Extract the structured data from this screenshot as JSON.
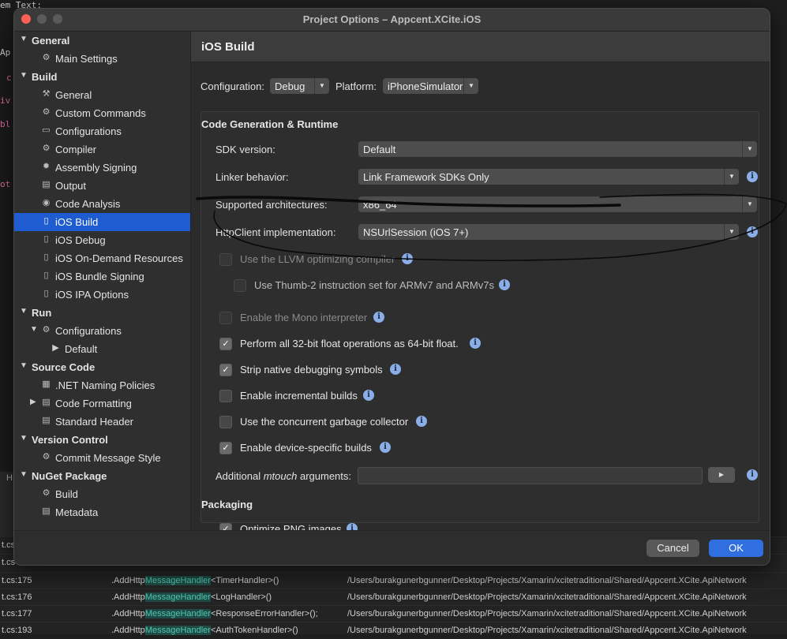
{
  "background_editor": {
    "code_lines": [
      "em Text;",
      "Ap",
      "c",
      "iv",
      "bl",
      "ot"
    ],
    "side_tab": "H"
  },
  "background_table": {
    "rows": [
      {
        "file": "t.cs:175",
        "prefix": ".AddHttp",
        "highlight": "MessageHandler",
        "suffix": "<TimerHandler>()",
        "path": "/Users/burakgunerbgunner/Desktop/Projects/Xamarin/xcitetraditional/Shared/Appcent.XCite.ApiNetwork"
      },
      {
        "file": "t.cs:176",
        "prefix": ".AddHttp",
        "highlight": "MessageHandler",
        "suffix": "<LogHandler>()",
        "path": "/Users/burakgunerbgunner/Desktop/Projects/Xamarin/xcitetraditional/Shared/Appcent.XCite.ApiNetwork"
      },
      {
        "file": "t.cs:177",
        "prefix": ".AddHttp",
        "highlight": "MessageHandler",
        "suffix": "<ResponseErrorHandler>();",
        "path": "/Users/burakgunerbgunner/Desktop/Projects/Xamarin/xcitetraditional/Shared/Appcent.XCite.ApiNetwork"
      },
      {
        "file": "t.cs:193",
        "prefix": ".AddHttp",
        "highlight": "MessageHandler",
        "suffix": "<AuthTokenHandler>()",
        "path": "/Users/burakgunerbgunner/Desktop/Projects/Xamarin/xcitetraditional/Shared/Appcent.XCite.ApiNetwork"
      }
    ],
    "partial_rows": [
      "t.cs",
      "t.cs"
    ]
  },
  "window": {
    "title": "Project Options – Appcent.XCite.iOS"
  },
  "sidebar": {
    "items": [
      {
        "label": "General",
        "type": "group",
        "icon": "chevron-down"
      },
      {
        "label": "Main Settings",
        "type": "item",
        "icon": "gear-icon"
      },
      {
        "label": "Build",
        "type": "group",
        "icon": "chevron-down"
      },
      {
        "label": "General",
        "type": "item",
        "icon": "hammer-icon"
      },
      {
        "label": "Custom Commands",
        "type": "item",
        "icon": "gear-icon"
      },
      {
        "label": "Configurations",
        "type": "item",
        "icon": "window-icon"
      },
      {
        "label": "Compiler",
        "type": "item",
        "icon": "compiler-icon"
      },
      {
        "label": "Assembly Signing",
        "type": "item",
        "icon": "seal-icon"
      },
      {
        "label": "Output",
        "type": "item",
        "icon": "output-icon"
      },
      {
        "label": "Code Analysis",
        "type": "item",
        "icon": "analysis-icon"
      },
      {
        "label": "iOS Build",
        "type": "item",
        "icon": "phone-icon",
        "active": true
      },
      {
        "label": "iOS Debug",
        "type": "item",
        "icon": "phone-icon"
      },
      {
        "label": "iOS On-Demand Resources",
        "type": "item",
        "icon": "phone-icon"
      },
      {
        "label": "iOS Bundle Signing",
        "type": "item",
        "icon": "phone-icon"
      },
      {
        "label": "iOS IPA Options",
        "type": "item",
        "icon": "phone-icon"
      },
      {
        "label": "Run",
        "type": "group",
        "icon": "chevron-down"
      },
      {
        "label": "Configurations",
        "type": "item",
        "icon": "gear-icon",
        "expandable": true
      },
      {
        "label": "Default",
        "type": "subitem",
        "icon": "play-icon"
      },
      {
        "label": "Source Code",
        "type": "group",
        "icon": "chevron-down"
      },
      {
        "label": ".NET Naming Policies",
        "type": "item",
        "icon": "naming-icon"
      },
      {
        "label": "Code Formatting",
        "type": "item",
        "icon": "format-icon",
        "collapsed": true
      },
      {
        "label": "Standard Header",
        "type": "item",
        "icon": "document-icon"
      },
      {
        "label": "Version Control",
        "type": "group",
        "icon": "chevron-down"
      },
      {
        "label": "Commit Message Style",
        "type": "item",
        "icon": "gear-icon"
      },
      {
        "label": "NuGet Package",
        "type": "group",
        "icon": "chevron-down"
      },
      {
        "label": "Build",
        "type": "item",
        "icon": "gear-icon"
      },
      {
        "label": "Metadata",
        "type": "item",
        "icon": "document-icon"
      }
    ]
  },
  "main": {
    "title": "iOS Build",
    "configuration_label": "Configuration:",
    "configuration_value": "Debug",
    "platform_label": "Platform:",
    "platform_value": "iPhoneSimulator",
    "section_codegen": "Code Generation & Runtime",
    "sdk_label": "SDK version:",
    "sdk_value": "Default",
    "linker_label": "Linker behavior:",
    "linker_value": "Link Framework SDKs Only",
    "arch_label": "Supported architectures:",
    "arch_value": "x86_64",
    "http_label": "HttpClient implementation:",
    "http_value": "NSUrlSession (iOS 7+)",
    "checkboxes": [
      {
        "label": "Use the LLVM optimizing compiler",
        "checked": false,
        "disabled": true
      },
      {
        "label": "Use Thumb-2 instruction set for ARMv7 and ARMv7s",
        "checked": false,
        "disabled": true
      },
      {
        "label": "Enable the Mono interpreter",
        "checked": false,
        "disabled": true
      },
      {
        "label": "Perform all 32-bit float operations as 64-bit float.",
        "checked": true,
        "disabled": false
      },
      {
        "label": "Strip native debugging symbols",
        "checked": true,
        "disabled": false
      },
      {
        "label": "Enable incremental builds",
        "checked": false,
        "disabled": false
      },
      {
        "label": "Use the concurrent garbage collector",
        "checked": false,
        "disabled": false
      },
      {
        "label": "Enable device-specific builds",
        "checked": true,
        "disabled": false
      }
    ],
    "mtouch_label_pre": "Additional ",
    "mtouch_label_em": "mtouch",
    "mtouch_label_post": " arguments:",
    "mtouch_value": "",
    "section_packaging": "Packaging",
    "packaging_partial": "Optimize PNG images"
  },
  "footer": {
    "cancel_label": "Cancel",
    "ok_label": "OK"
  },
  "colors": {
    "accent": "#2f6fe0",
    "selection": "#1f5bd1",
    "info": "#8aaee8"
  }
}
